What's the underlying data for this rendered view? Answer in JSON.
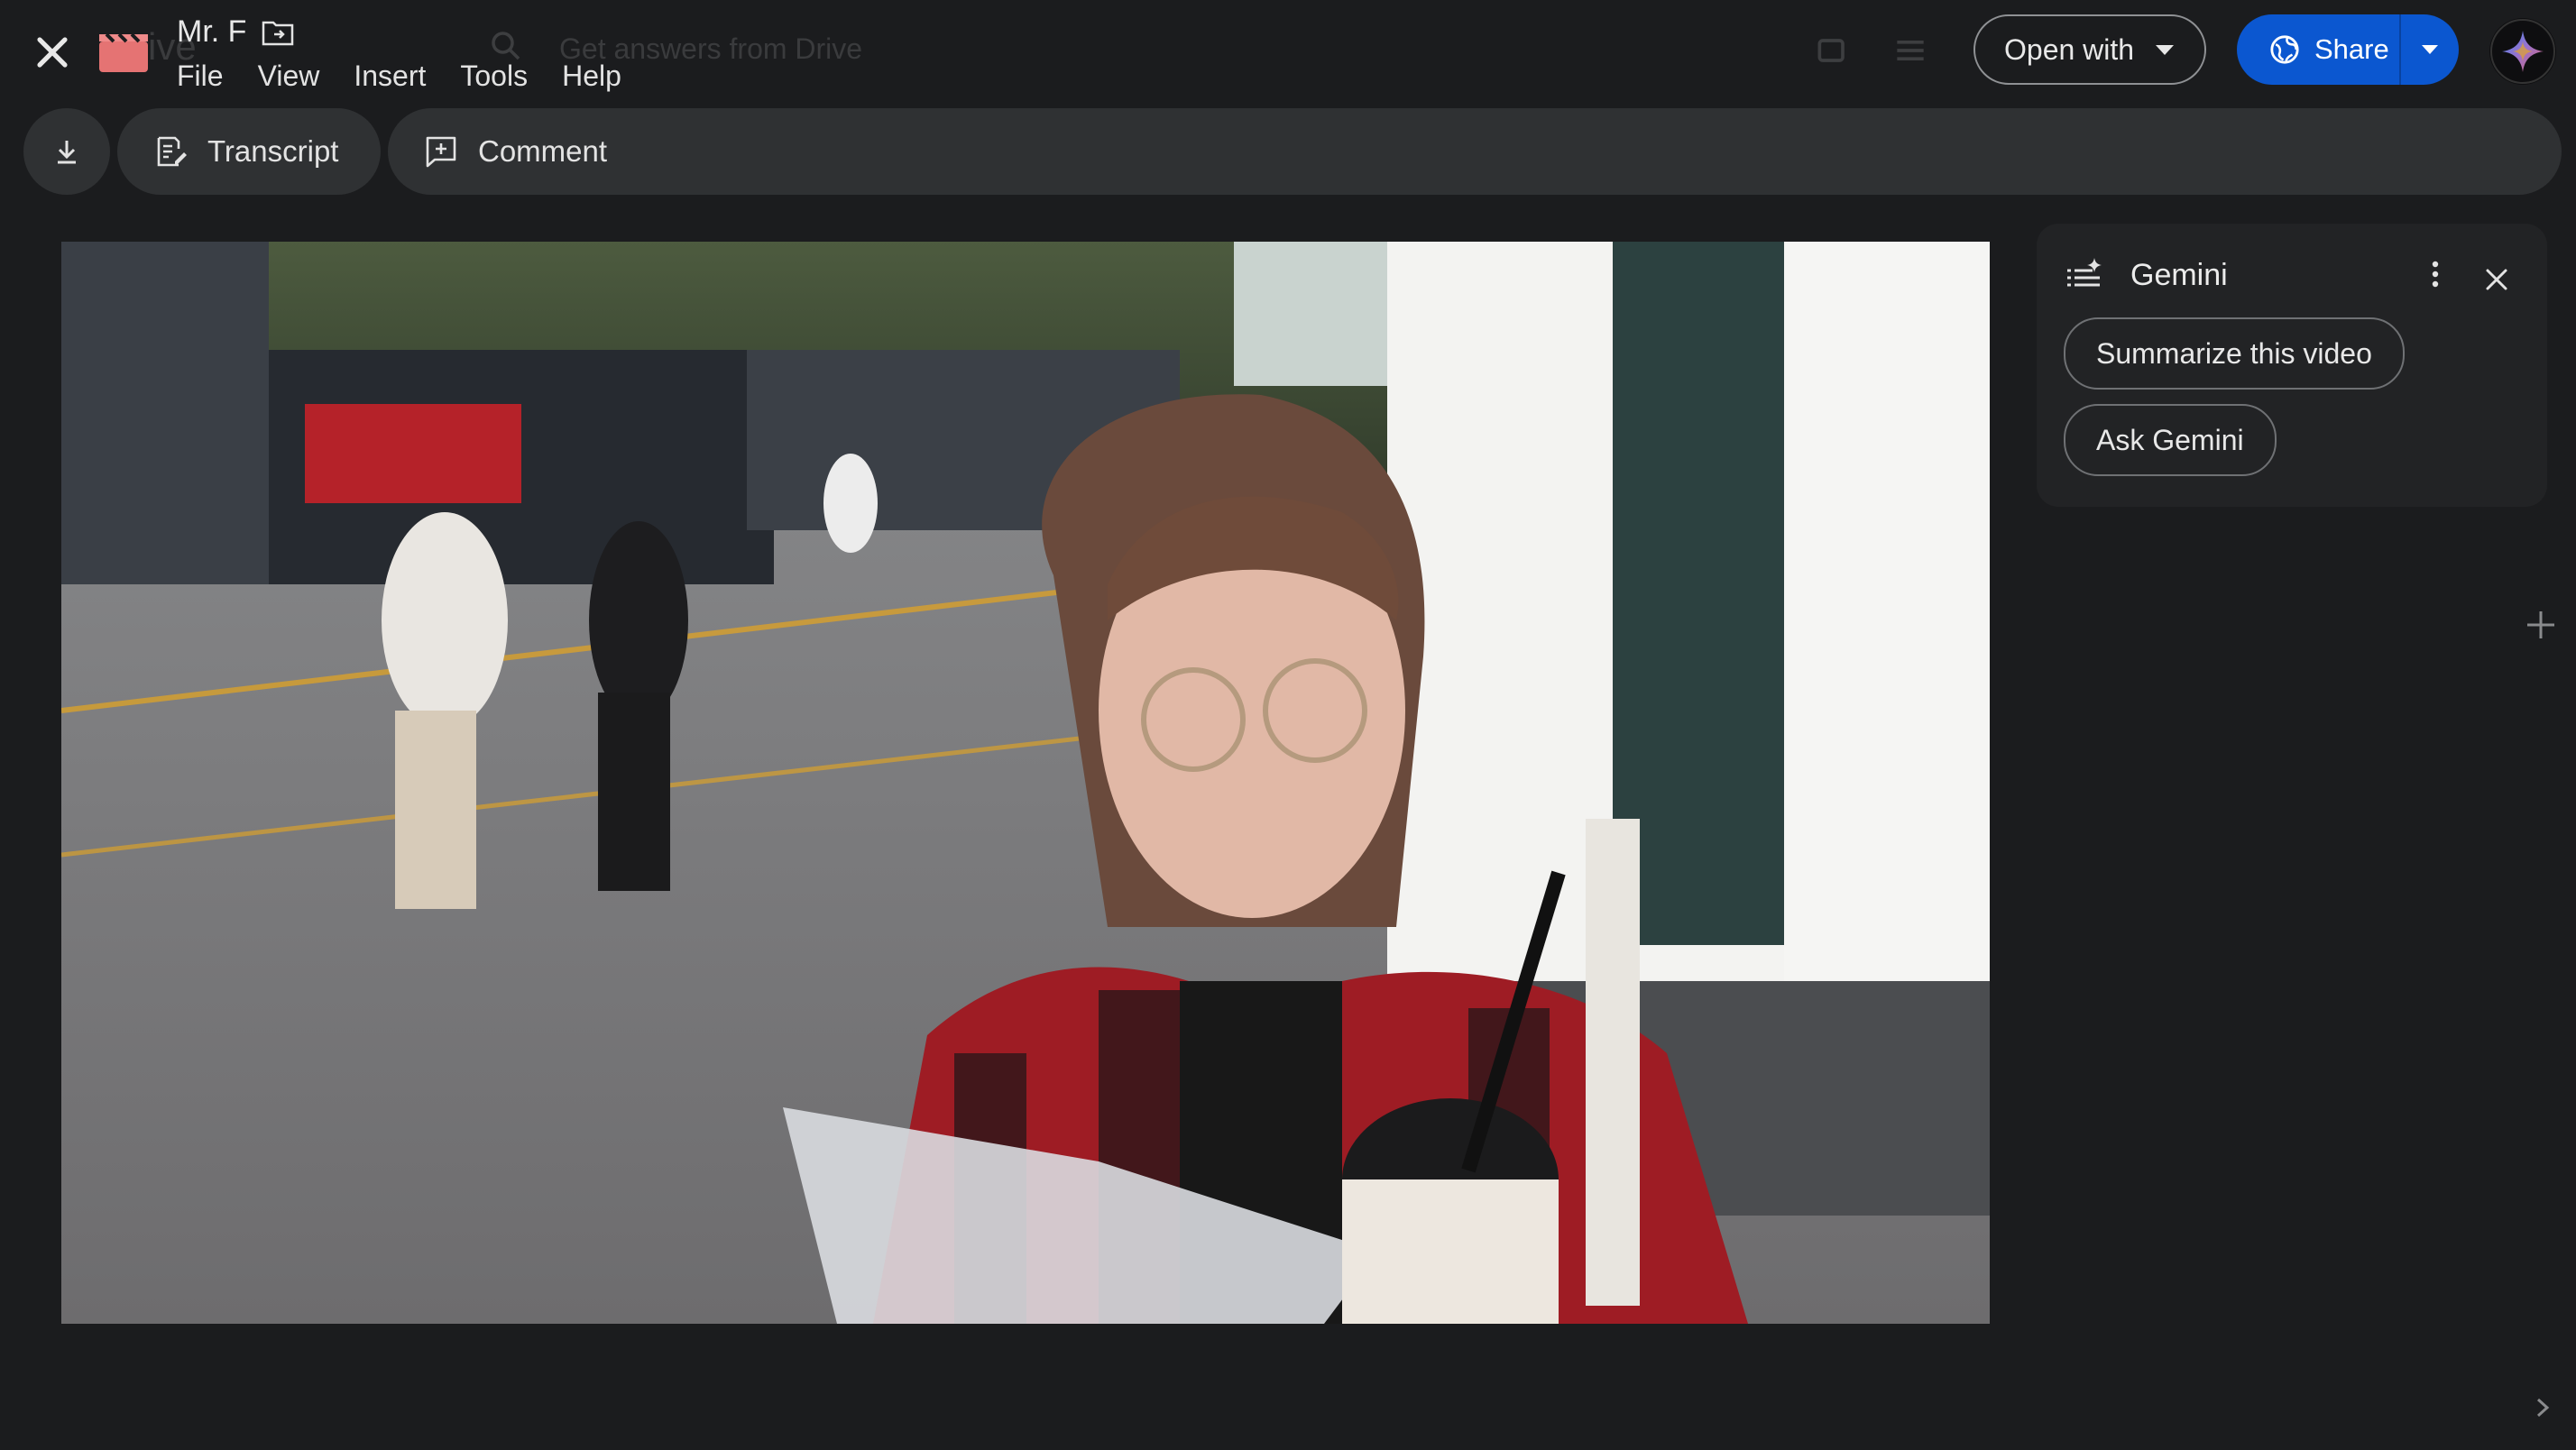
{
  "background_ui": {
    "logo_text": "rive",
    "search_placeholder": "Get answers from Drive"
  },
  "header": {
    "doc_title": "Mr. F",
    "menu": [
      "File",
      "View",
      "Insert",
      "Tools",
      "Help"
    ],
    "open_with_label": "Open with",
    "share_label": "Share"
  },
  "toolbar": {
    "transcript_label": "Transcript",
    "comment_label": "Comment"
  },
  "gemini_panel": {
    "title": "Gemini",
    "suggestions": [
      "Summarize this video",
      "Ask Gemini"
    ]
  },
  "colors": {
    "background": "#1b1c1e",
    "toolbar": "#2f3133",
    "share_blue": "#0b57d0",
    "panel": "#222325",
    "file_icon_red": "#e57373"
  },
  "icons": [
    "close-icon",
    "video-file-icon",
    "move-to-folder-icon",
    "caret-down-icon",
    "globe-icon",
    "gemini-spark-icon",
    "download-icon",
    "transcript-icon",
    "comment-icon",
    "gemini-list-icon",
    "more-vert-icon",
    "plus-icon",
    "chevron-right-icon"
  ]
}
